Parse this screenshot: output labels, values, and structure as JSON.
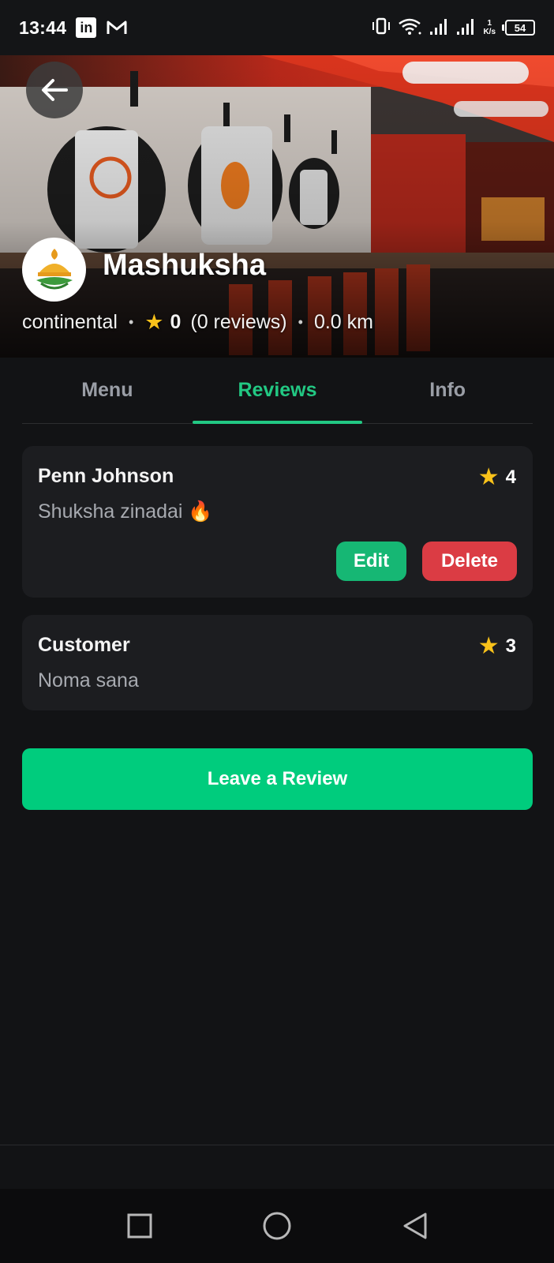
{
  "status_bar": {
    "time": "13:44",
    "netspeed_value": "1",
    "netspeed_unit": "K/s",
    "battery": "54"
  },
  "restaurant": {
    "name": "Mashuksha",
    "cuisine": "continental",
    "rating": "0",
    "reviews_count": "(0 reviews)",
    "distance": "0.0 km"
  },
  "tabs": [
    {
      "label": "Menu",
      "active": false
    },
    {
      "label": "Reviews",
      "active": true
    },
    {
      "label": "Info",
      "active": false
    }
  ],
  "reviews": [
    {
      "author": "Penn Johnson",
      "rating": "4",
      "comment": "Shuksha zinadai 🔥",
      "edit_label": "Edit",
      "delete_label": "Delete"
    },
    {
      "author": "Customer",
      "rating": "3",
      "comment": "Noma sana"
    }
  ],
  "actions": {
    "leave_review": "Leave a Review"
  },
  "colors": {
    "accent": "#22c883",
    "primary_button": "#00cc7d",
    "delete": "#db3c44",
    "star": "#f9c21a",
    "background": "#121315",
    "card": "#1c1d20"
  },
  "icons": {
    "back": "arrow-left-icon",
    "star": "star-icon",
    "nav": [
      "square-recents-icon",
      "circle-home-icon",
      "triangle-back-icon"
    ]
  }
}
